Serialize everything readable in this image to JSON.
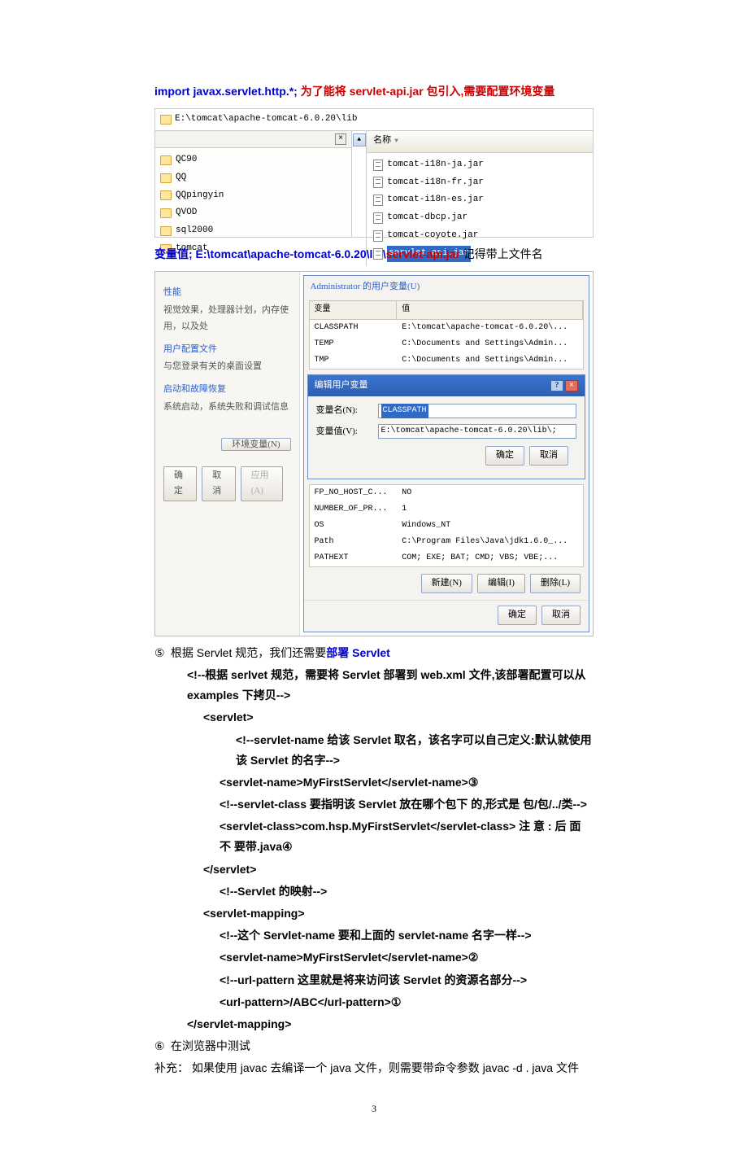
{
  "top": {
    "import_pre": "import javax.servlet.http.*;",
    "after_import": "为了能将 servlet-api.jar 包引入,需要配置环境变量"
  },
  "fig1": {
    "address": "E:\\tomcat\\apache-tomcat-6.0.20\\lib",
    "left_items": [
      "QC90",
      "QQ",
      "QQpingyin",
      "QVOD",
      "sql2000",
      "tomcat"
    ],
    "right_header": "名称",
    "right_items": [
      "tomcat-i18n-ja.jar",
      "tomcat-i18n-fr.jar",
      "tomcat-i18n-es.jar",
      "tomcat-dbcp.jar",
      "tomcat-coyote.jar"
    ],
    "right_selected": "servlet-api.jar",
    "close_x": "×",
    "scroll_up": "▲"
  },
  "varline": {
    "pre": "变量值",
    "path_a": "; E:\\tomcat\\apache-tomcat-6.0.20\\lib\\",
    "path_b": "servlet-api.jar",
    "tail": "记得带上文件名"
  },
  "fig2": {
    "left": {
      "g1t": "性能",
      "g1d": "视觉效果，处理器计划，内存使用，以及处",
      "g2t": "用户配置文件",
      "g2d": "与您登录有关的桌面设置",
      "g3t": "启动和故障恢复",
      "g3d": "系统启动，系统失败和调试信息",
      "env_btn": "环境变量(N)"
    },
    "upper_title": "Administrator 的用户变量(U)",
    "col_var": "变量",
    "col_val": "值",
    "user_rows": [
      {
        "n": "CLASSPATH",
        "v": "E:\\tomcat\\apache-tomcat-6.0.20\\..."
      },
      {
        "n": "TEMP",
        "v": "C:\\Documents and Settings\\Admin..."
      },
      {
        "n": "TMP",
        "v": "C:\\Documents and Settings\\Admin..."
      }
    ],
    "edit_dlg_title": "编辑用户变量",
    "name_lbl": "变量名(N):",
    "name_val": "CLASSPATH",
    "val_lbl": "变量值(V):",
    "val_val": "E:\\tomcat\\apache-tomcat-6.0.20\\lib\\;",
    "ok": "确定",
    "cancel": "取消",
    "apply": "应用(A)",
    "sys_rows": [
      {
        "n": "FP_NO_HOST_C...",
        "v": "NO"
      },
      {
        "n": "NUMBER_OF_PR...",
        "v": "1"
      },
      {
        "n": "OS",
        "v": "Windows_NT"
      },
      {
        "n": "Path",
        "v": "C:\\Program Files\\Java\\jdk1.6.0_..."
      },
      {
        "n": "PATHEXT",
        "v": "COM; EXE; BAT; CMD; VBS; VBE;..."
      }
    ],
    "new_btn": "新建(N)",
    "edit_btn": "编辑(I)",
    "del_btn": "删除(L)"
  },
  "s5": {
    "num": "⑤",
    "head_pre": "根据 Servlet 规范，我们还需要",
    "head_blue": "部署 Servlet",
    "l1": "<!--根据 serlvet 规范，需要将 Servlet 部署到 web.xml 文件,该部署配置可以从examples 下拷贝-->",
    "l2": "<servlet>",
    "l3": "<!--servlet-name 给该 Servlet 取名，该名字可以自己定义:默认就使用该 Servlet 的名字-->",
    "l4": "<servlet-name>MyFirstServlet</servlet-name>③",
    "l5": "<!--servlet-class 要指明该 Servlet  放在哪个包下  的,形式是 包/包/../类-->",
    "l6a": "<servlet-class>com.hsp.MyFirstServlet</servlet-class>",
    "l6b": "注 意 : 后 面 不 要带.java④",
    "l7": "</servlet>",
    "l8": "<!--Servlet 的映射-->",
    "l9": "<servlet-mapping>",
    "l10": "<!--这个 Servlet-name 要和上面的 servlet-name 名字一样-->",
    "l11": "<servlet-name>MyFirstServlet</servlet-name>②",
    "l12": "<!--url-pattern  这里就是将来访问该 Servlet 的资源名部分-->",
    "l13": "<url-pattern>/ABC</url-pattern>①",
    "l14": "</servlet-mapping>"
  },
  "s6": {
    "num": "⑥",
    "text": "在浏览器中测试"
  },
  "supp": "补充：  如果使用 javac  去编译一个 java 文件，则需要带命令参数 javac   -d   .    java 文件",
  "page": "3"
}
